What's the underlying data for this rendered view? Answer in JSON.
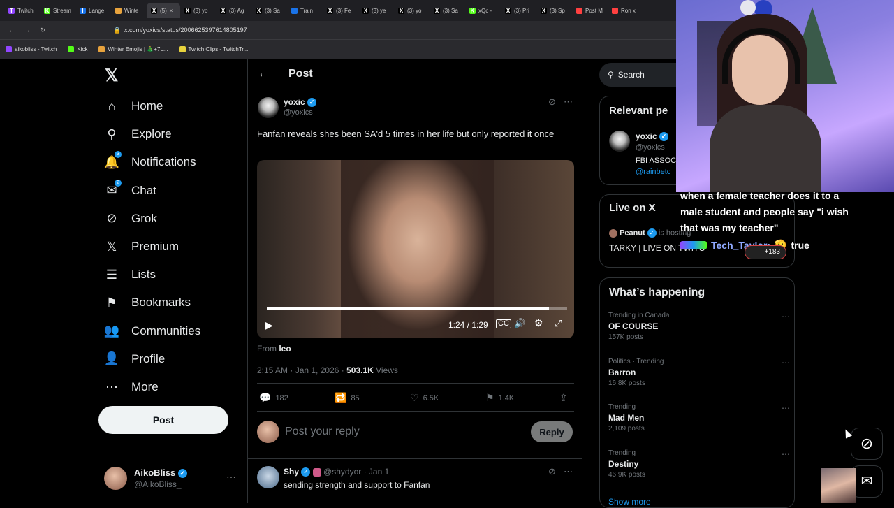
{
  "browser": {
    "tabs": [
      {
        "label": "Twitch",
        "color": "#9146ff",
        "glyph": "T"
      },
      {
        "label": "Stream",
        "color": "#53fc18",
        "glyph": "K"
      },
      {
        "label": "Lange",
        "color": "#1a73e8",
        "glyph": "l"
      },
      {
        "label": "Winte",
        "color": "#e8a33d",
        "glyph": ""
      },
      {
        "label": "(5)",
        "color": "#000000",
        "glyph": "X"
      },
      {
        "label": "(3) yo",
        "color": "#000000",
        "glyph": "X"
      },
      {
        "label": "(3) Ag",
        "color": "#000000",
        "glyph": "X"
      },
      {
        "label": "(3) Sa",
        "color": "#000000",
        "glyph": "X"
      },
      {
        "label": "Train",
        "color": "#1a73e8",
        "glyph": ""
      },
      {
        "label": "(3) Fe",
        "color": "#000000",
        "glyph": "X"
      },
      {
        "label": "(3) ye",
        "color": "#000000",
        "glyph": "X"
      },
      {
        "label": "(3) yo",
        "color": "#000000",
        "glyph": "X"
      },
      {
        "label": "(3) Sa",
        "color": "#000000",
        "glyph": "X"
      },
      {
        "label": "xQc -",
        "color": "#53fc18",
        "glyph": "K"
      },
      {
        "label": "(3) Pri",
        "color": "#000000",
        "glyph": "X"
      },
      {
        "label": "(3) Sp",
        "color": "#000000",
        "glyph": "X"
      },
      {
        "label": "Post M",
        "color": "#ff4040",
        "glyph": ""
      },
      {
        "label": "Ron x",
        "color": "#ff4040",
        "glyph": ""
      }
    ],
    "url": "x.com/yoxics/status/2006625397614805197",
    "bookmarks": [
      {
        "label": "aikobliss - Twitch",
        "color": "#9146ff"
      },
      {
        "label": "Kick",
        "color": "#53fc18"
      },
      {
        "label": "Winter Emojis | 🎄+7L...",
        "color": "#e8a33d"
      },
      {
        "label": "Twitch Clips - TwitchTr...",
        "color": "#e8d33d"
      }
    ]
  },
  "nav": {
    "items": [
      {
        "label": "Home",
        "icon": "home-icon",
        "glyph": "⌂",
        "badge": ""
      },
      {
        "label": "Explore",
        "icon": "search-icon",
        "glyph": "⚲",
        "badge": ""
      },
      {
        "label": "Notifications",
        "icon": "bell-icon",
        "glyph": "🔔",
        "badge": "3"
      },
      {
        "label": "Chat",
        "icon": "mail-icon",
        "glyph": "✉",
        "badge": "2"
      },
      {
        "label": "Grok",
        "icon": "grok-icon",
        "glyph": "⊘",
        "badge": ""
      },
      {
        "label": "Premium",
        "icon": "x-logo-icon",
        "glyph": "𝕏",
        "badge": ""
      },
      {
        "label": "Lists",
        "icon": "list-icon",
        "glyph": "☰",
        "badge": ""
      },
      {
        "label": "Bookmarks",
        "icon": "bookmark-icon",
        "glyph": "⚑",
        "badge": ""
      },
      {
        "label": "Communities",
        "icon": "people-icon",
        "glyph": "👥",
        "badge": ""
      },
      {
        "label": "Profile",
        "icon": "person-icon",
        "glyph": "👤",
        "badge": ""
      },
      {
        "label": "More",
        "icon": "more-circle-icon",
        "glyph": "⋯",
        "badge": ""
      }
    ],
    "post_button": "Post",
    "account": {
      "name": "AikoBliss",
      "handle": "@AikoBliss_"
    }
  },
  "header": {
    "title": "Post"
  },
  "post": {
    "author": "yoxic",
    "handle": "@yoxics",
    "text": "Fanfan reveals shes been SA'd 5 times in her life but only reported it once",
    "video": {
      "time": "1:24 / 1:29",
      "progress": 0.94
    },
    "from_label": "From",
    "from_user": "leo",
    "timestamp": "2:15 AM · Jan 1, 2026 ·",
    "views": "503.1K",
    "views_label": "Views",
    "stats": {
      "replies": "182",
      "reposts": "85",
      "likes": "6.5K",
      "bookmarks": "1.4K"
    },
    "reply_placeholder": "Post your reply",
    "reply_button": "Reply"
  },
  "reply_post": {
    "author": "Shy",
    "handle": "@shydyor · Jan 1",
    "text": "sending strength and support to Fanfan"
  },
  "right": {
    "search_placeholder": "Search",
    "relevant": {
      "title": "Relevant pe",
      "name": "yoxic",
      "handle": "@yoxics",
      "bio": "FBI ASSOC",
      "link": "@rainbetc"
    },
    "live": {
      "title": "Live on X",
      "host": "Peanut",
      "host_suffix": "is hosting",
      "stream": "TARKY | LIVE ON TWITC"
    },
    "happening_title": "What’s happening",
    "trends": [
      {
        "meta": "Trending in Canada",
        "name": "OF COURSE",
        "count": "157K posts"
      },
      {
        "meta": "Politics · Trending",
        "name": "Barron",
        "count": "16.8K posts"
      },
      {
        "meta": "Trending",
        "name": "Mad Men",
        "count": "2,109 posts"
      },
      {
        "meta": "Trending",
        "name": "Destiny",
        "count": "46.9K posts"
      }
    ],
    "show_more": "Show more"
  },
  "overlay": {
    "caption1": "when a female teacher does it to a",
    "caption2": "male student and people say \"i wish",
    "caption3": "that was my teacher\"",
    "chat_user": "Tech_Taylor:",
    "chat_msg": "true",
    "viewer_count": "+183"
  }
}
